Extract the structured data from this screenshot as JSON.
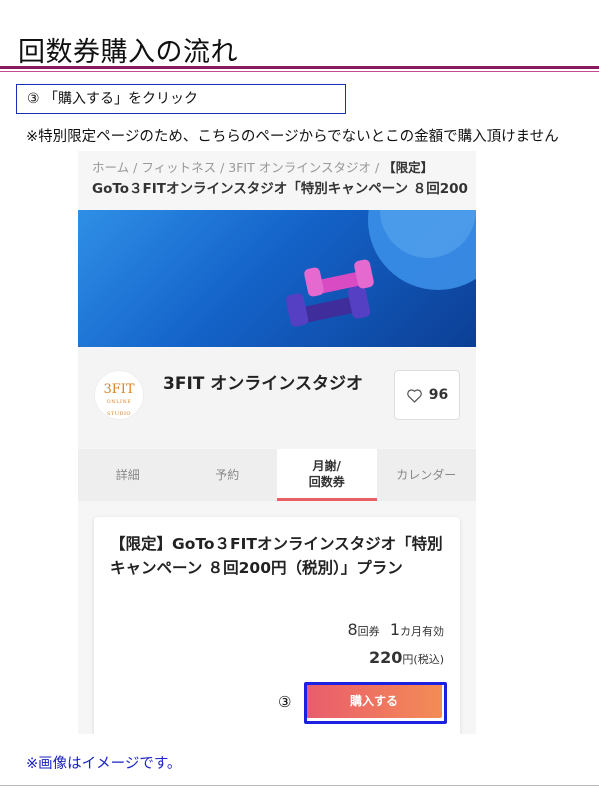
{
  "slide": {
    "title": "回数券購入の流れ",
    "step_label": "③ 「購入する」をクリック",
    "note_top": "※特別限定ページのため、こちらのページからでないとこの金額で購入頂けません",
    "note_bottom": "※画像はイメージです。",
    "step_marker": "③"
  },
  "screenshot": {
    "breadcrumb": {
      "items": [
        "ホーム",
        "フィットネス",
        "3FIT オンラインスタジオ"
      ],
      "separator": "/",
      "limited": "【限定】"
    },
    "page_heading": "GoTo３FITオンラインスタジオ「特別キャンペーン ８回200",
    "shop": {
      "logo_text": "3FIT",
      "logo_sub": "ONLINE STUDIO",
      "name": "3FIT オンラインスタジオ",
      "favorite_count": "96"
    },
    "tabs": [
      {
        "label": "詳細",
        "active": false
      },
      {
        "label": "予約",
        "active": false
      },
      {
        "label": "月謝/\n回数券",
        "active": true
      },
      {
        "label": "カレンダー",
        "active": false
      }
    ],
    "plan": {
      "title": "【限定】GoTo３FITオンラインスタジオ「特別キャンペーン ８回200円（税別）」プラン",
      "tickets_num": "8",
      "tickets_unit": "回券",
      "valid_num": "1",
      "valid_unit": "カ月有効",
      "price_num": "220",
      "price_unit": "円(税込)",
      "buy_label": "購入する"
    }
  },
  "colors": {
    "title_rule": "#8b1a5e",
    "step_box_border": "#1a2fb5",
    "highlight": "#1a21e0",
    "buy_gradient_start": "#e95c6d",
    "buy_gradient_end": "#f38c55",
    "tab_active_underline": "#e86062",
    "note_bottom": "#1a21c4"
  }
}
